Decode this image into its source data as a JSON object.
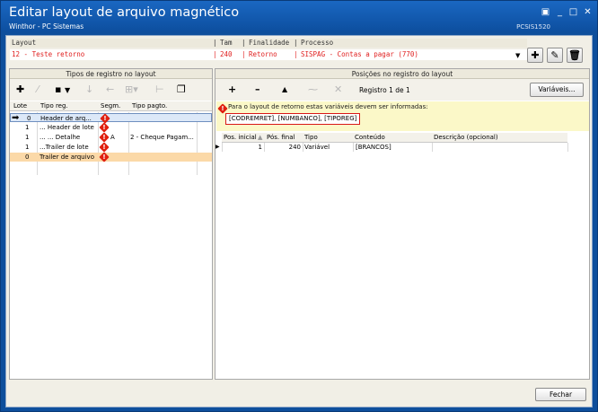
{
  "window": {
    "title": "Editar layout de arquivo magnético",
    "subtitle": "Winthor - PC Sistemas",
    "code": "PCSIS1520",
    "controls": [
      "resize-icon",
      "minimize-icon",
      "maximize-icon",
      "close-icon"
    ]
  },
  "layout": {
    "headers": {
      "layout": "Layout",
      "tam": "Tam",
      "finalidade": "Finalidade",
      "processo": "Processo"
    },
    "row": {
      "layout": "12 - Teste retorno",
      "tam": "240",
      "finalidade": "Retorno",
      "processo": "SISPAG - Contas a pagar (770)"
    },
    "buttons": [
      "plus-icon",
      "pencil-icon",
      "trash-icon"
    ]
  },
  "left": {
    "title": "Tipos de registro no layout",
    "toolbar": [
      "add-icon",
      "magic-icon",
      "delete-icon",
      "dropdown-icon",
      "arrow-down-icon",
      "arrow-left-icon",
      "fill-icon",
      "tree-icon",
      "copy-icon"
    ],
    "columns": [
      "Lote",
      "Tipo reg.",
      "Segm.",
      "Tipo pagto."
    ],
    "rows": [
      {
        "lote": "0",
        "tipo": "Header de arq...",
        "segm": "",
        "pagto": "",
        "selected": true
      },
      {
        "lote": "1",
        "tipo": "... Header de lote",
        "segm": "",
        "pagto": ""
      },
      {
        "lote": "1",
        "tipo": "... ... Detalhe",
        "segm": "A",
        "pagto": "2 - Cheque Pagam..."
      },
      {
        "lote": "1",
        "tipo": "...Trailer de lote",
        "segm": "",
        "pagto": ""
      },
      {
        "lote": "0",
        "tipo": "Trailer de arquivo",
        "segm": "",
        "pagto": "",
        "highlight": true
      }
    ]
  },
  "right": {
    "title": "Posições no registro do layout",
    "toolbar": [
      "plus-icon",
      "minus-icon",
      "up-icon",
      "down-icon",
      "clear-icon"
    ],
    "registro": "Registro 1 de 1",
    "variaveis": "Variáveis...",
    "note": "Para o layout de retorno estas variáveis devem ser informadas:",
    "vars": "[CODREMRET], [NUMBANCO], [TIPOREG]",
    "columns": [
      "Pos. inicial",
      "Pós. final",
      "Tipo",
      "Conteúdo",
      "Descrição (opcional)"
    ],
    "rows": [
      {
        "inicial": "1",
        "final": "240",
        "tipo": "Variável",
        "conteudo": "[BRANCOS]",
        "descricao": ""
      }
    ]
  },
  "footer": {
    "fechar": "Fechar"
  },
  "colors": {
    "title_bg": "#0d4f9f",
    "error": "#e02010",
    "highlight": "#fbd9a8",
    "selected": "#dce8f8"
  }
}
